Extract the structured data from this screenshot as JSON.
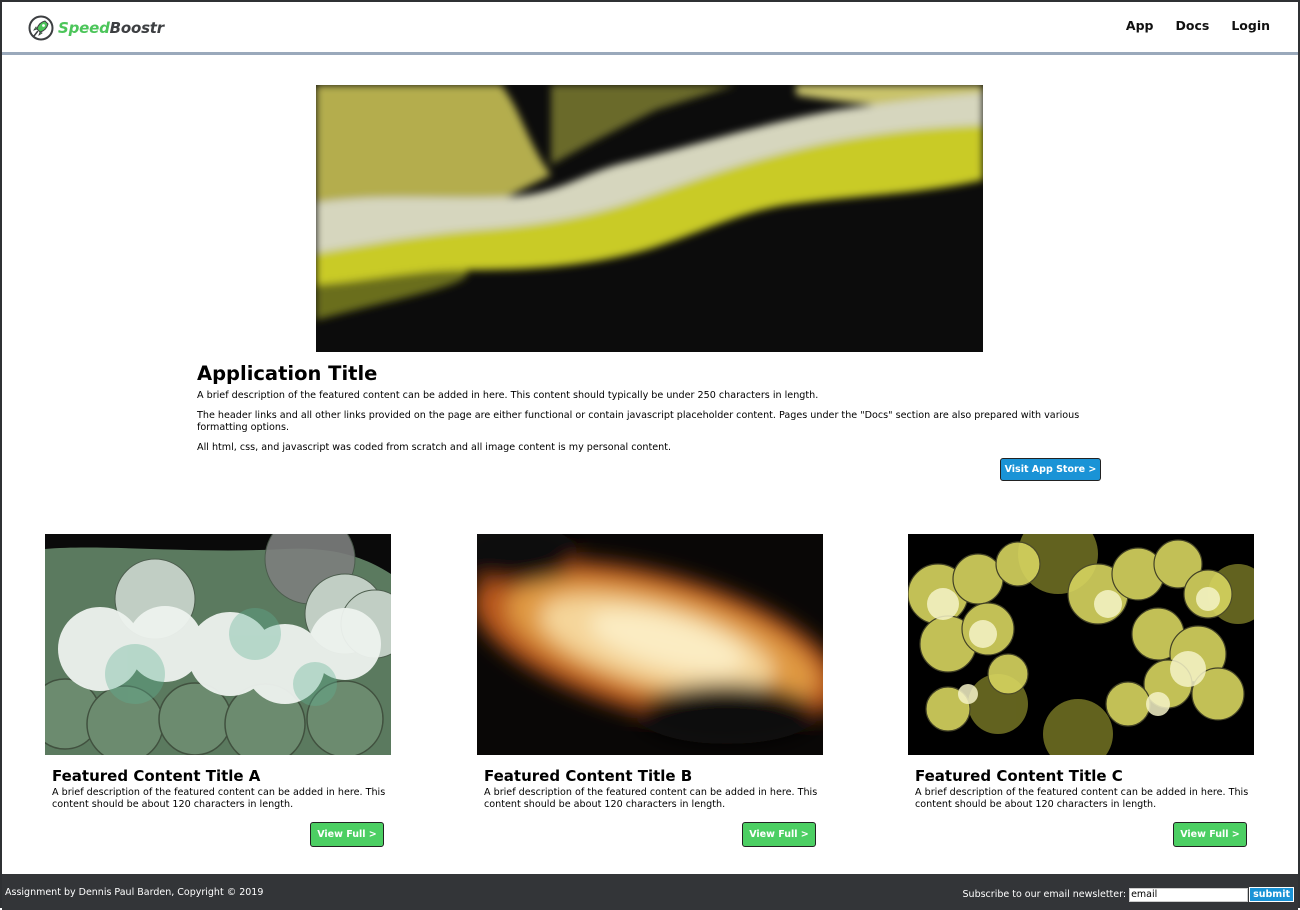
{
  "brand": {
    "name_part1": "Speed",
    "name_part2": "Boostr",
    "logo_icon": "rocket-icon",
    "colors": {
      "green": "#4cc55a",
      "dark": "#3d3f42"
    }
  },
  "nav": {
    "items": [
      {
        "label": "App"
      },
      {
        "label": "Docs"
      },
      {
        "label": "Login"
      }
    ]
  },
  "hero": {
    "title": "Application Title",
    "paragraphs": [
      "A brief description of the featured content can be added in here. This content should typically be under 250 characters in length.",
      "The header links and all other links provided on the page are either functional or contain javascript placeholder content. Pages under the \"Docs\" section are also prepared with various formatting options.",
      "All html, css, and javascript was coded from scratch and all image content is my personal content."
    ],
    "button_label": "Visit App Store >",
    "button_color": "#1a93d6"
  },
  "features": [
    {
      "title": "Featured Content Title A",
      "description": "A brief description of the featured content can be added in here. This content should be about 120 characters in length.",
      "button_label": "View Full >"
    },
    {
      "title": "Featured Content Title B",
      "description": "A brief description of the featured content can be added in here. This content should be about 120 characters in length.",
      "button_label": "View Full >"
    },
    {
      "title": "Featured Content Title C",
      "description": "A brief description of the featured content can be added in here. This content should be about 120 characters in length.",
      "button_label": "View Full >"
    }
  ],
  "footer": {
    "copyright": "Assignment by Dennis Paul Barden, Copyright © 2019",
    "newsletter_label": "Subscribe to our email newsletter:",
    "email_placeholder": "email",
    "email_value": "email",
    "submit_label": "submit"
  }
}
